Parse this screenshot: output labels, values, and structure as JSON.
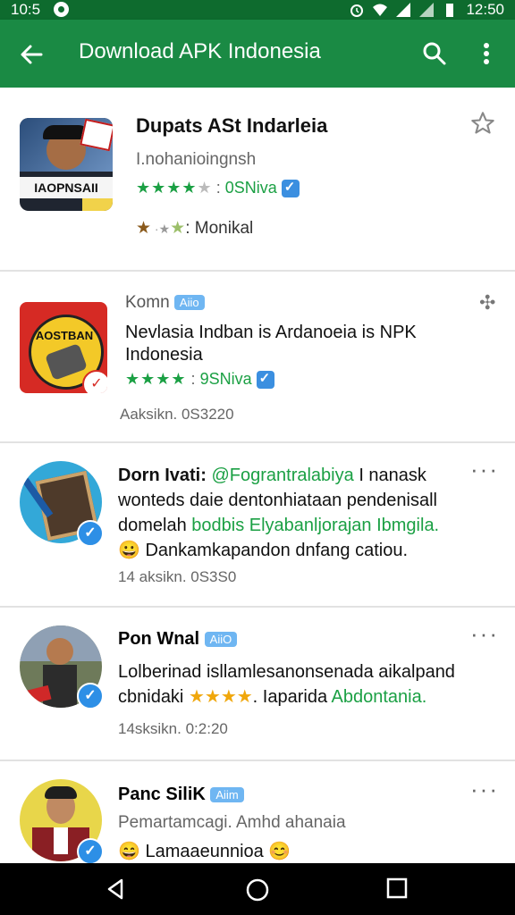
{
  "status": {
    "time_left": "10:5",
    "time_right": "12:50"
  },
  "appbar": {
    "title": "Download APK Indonesia"
  },
  "cards": [
    {
      "title": "Dupats ASt Indarleia",
      "subtitle": "I.nohanioingnsh",
      "stars": "★★★★",
      "rating_label": "0SNiva",
      "rating2_label": "Monikal",
      "thumb_text": "IAOPNSAII"
    },
    {
      "author": "Komn",
      "badge": "Aiio",
      "title": "Nevlasia Indban is Ardanoeia is NPK Indonesia",
      "stars": "★★★★",
      "rating_label": "9SNiva",
      "meta": "Aaksikn. 0S3220",
      "thumb_text": "AOSTBAN"
    }
  ],
  "posts": [
    {
      "author": "Dorn Ivati:",
      "mention": "@Fograntralabiya",
      "line1_tail": "I nanask",
      "line2": "wonteds daie dentonhiataan pendenisall",
      "line3_a": "domelah",
      "line3_b": "bodbis Elyabanljorajan Ibmgila.",
      "line4": "Dankamkapandon dnfang catiou.",
      "emoji": "😀",
      "meta": "14 aksikn. 0S3S0"
    },
    {
      "author": "Pon Wnal",
      "badge": "AiiO",
      "line1": "Lolberinad isllamlesanonsenada aikalpand",
      "line2_a": "cbnidaki",
      "line2_stars": "★★★★",
      "line2_b": ". Iaparida",
      "line2_c": "Abdontania.",
      "meta": "14sksikn. 0:2:20"
    },
    {
      "author": "Panc SiliK",
      "badge": "Aiim",
      "line1": "Pemartamcagi. Amhd ahanaia",
      "line2": "Lamaaeunnioa",
      "emoji1": "😄",
      "emoji2": "😊"
    }
  ]
}
